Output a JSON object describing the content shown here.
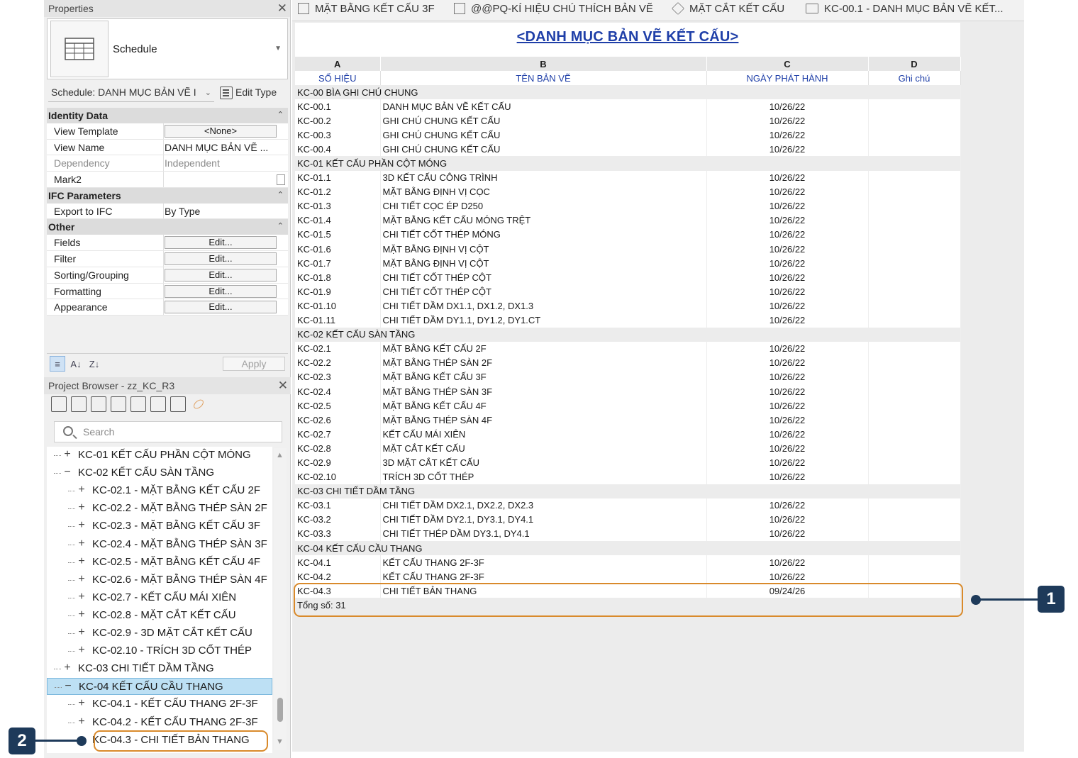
{
  "properties": {
    "title": "Properties",
    "type_name": "Schedule",
    "instance_label": "Schedule: DANH MỤC BẢN VẼ I",
    "edit_type": "Edit Type",
    "apply": "Apply",
    "sections": [
      {
        "title": "Identity Data",
        "rows": [
          {
            "name": "View Template",
            "value": "<None>",
            "kind": "button"
          },
          {
            "name": "View Name",
            "value": "DANH MỤC BẢN VẼ ...",
            "kind": "text"
          },
          {
            "name": "Dependency",
            "value": "Independent",
            "kind": "disabled"
          },
          {
            "name": "Mark2",
            "value": "",
            "kind": "check"
          }
        ]
      },
      {
        "title": "IFC Parameters",
        "rows": [
          {
            "name": "Export to IFC",
            "value": "By Type",
            "kind": "text"
          }
        ]
      },
      {
        "title": "Other",
        "rows": [
          {
            "name": "Fields",
            "value": "Edit...",
            "kind": "button"
          },
          {
            "name": "Filter",
            "value": "Edit...",
            "kind": "button"
          },
          {
            "name": "Sorting/Grouping",
            "value": "Edit...",
            "kind": "button"
          },
          {
            "name": "Formatting",
            "value": "Edit...",
            "kind": "button"
          },
          {
            "name": "Appearance",
            "value": "Edit...",
            "kind": "button"
          }
        ]
      }
    ]
  },
  "project_browser": {
    "title": "Project Browser - zz_KC_R3",
    "search_placeholder": "Search",
    "nodes": [
      {
        "level": 0,
        "toggle": "+",
        "label": "KC-01 KẾT CẤU PHẦN CỘT MÓNG"
      },
      {
        "level": 0,
        "toggle": "−",
        "label": "KC-02 KẾT CẤU SÀN TẦNG"
      },
      {
        "level": 1,
        "toggle": "+",
        "label": "KC-02.1 - MẶT BẰNG KẾT CẤU 2F"
      },
      {
        "level": 1,
        "toggle": "+",
        "label": "KC-02.2 - MẶT BẰNG THÉP SÀN 2F"
      },
      {
        "level": 1,
        "toggle": "+",
        "label": "KC-02.3 - MẶT BẰNG KẾT CẤU 3F"
      },
      {
        "level": 1,
        "toggle": "+",
        "label": "KC-02.4 - MẶT BẰNG THÉP SÀN 3F"
      },
      {
        "level": 1,
        "toggle": "+",
        "label": "KC-02.5 - MẶT BẰNG KẾT CẤU 4F"
      },
      {
        "level": 1,
        "toggle": "+",
        "label": "KC-02.6 - MẶT BẰNG THÉP SÀN 4F"
      },
      {
        "level": 1,
        "toggle": "+",
        "label": "KC-02.7 - KẾT CẤU MÁI XIÊN"
      },
      {
        "level": 1,
        "toggle": "+",
        "label": "KC-02.8 - MẶT CẮT KẾT CẤU"
      },
      {
        "level": 1,
        "toggle": "+",
        "label": "KC-02.9 - 3D MẶT CẮT KẾT CẤU"
      },
      {
        "level": 1,
        "toggle": "+",
        "label": "KC-02.10 - TRÍCH 3D CỐT THÉP"
      },
      {
        "level": 0,
        "toggle": "+",
        "label": "KC-03 CHI TIẾT DẦM TẦNG"
      },
      {
        "level": 0,
        "toggle": "−",
        "label": "KC-04 KẾT CẤU CẦU THANG",
        "selected": true
      },
      {
        "level": 1,
        "toggle": "+",
        "label": "KC-04.1 - KẾT CẤU THANG 2F-3F"
      },
      {
        "level": 1,
        "toggle": "+",
        "label": "KC-04.2 - KẾT CẤU THANG 2F-3F"
      },
      {
        "level": 1,
        "toggle": "",
        "label": "KC-04.3 - CHI TIẾT BẢN THANG"
      }
    ]
  },
  "tabs": [
    {
      "label": "MẶT BẰNG KẾT CẤU 3F",
      "icon": "floor-plan-icon"
    },
    {
      "label": "@@PQ-KÍ HIỆU CHÚ THÍCH BẢN VẼ",
      "icon": "legend-icon"
    },
    {
      "label": "MẶT CẮT KẾT CẤU",
      "icon": "section-icon"
    },
    {
      "label": "KC-00.1 - DANH MỤC BẢN VẼ KẾT...",
      "icon": "sheet-icon"
    }
  ],
  "schedule": {
    "title": "<DANH MỤC BẢN VẼ KẾT CẤU>",
    "column_letters": [
      "A",
      "B",
      "C",
      "D"
    ],
    "column_headers": [
      "SỐ HIỆU",
      "TÊN BẢN VẼ",
      "NGÀY PHÁT HÀNH",
      "Ghi chú"
    ],
    "rows": [
      {
        "group": "KC-00 BÌA GHI CHÚ CHUNG"
      },
      {
        "no": "KC-00.1",
        "name": "DANH MỤC BẢN VẼ KẾT CẤU",
        "date": "10/26/22"
      },
      {
        "no": "KC-00.2",
        "name": "GHI CHÚ CHUNG KẾT CẤU",
        "date": "10/26/22"
      },
      {
        "no": "KC-00.3",
        "name": "GHI CHÚ CHUNG KẾT CẤU",
        "date": "10/26/22"
      },
      {
        "no": "KC-00.4",
        "name": "GHI CHÚ CHUNG KẾT CẤU",
        "date": "10/26/22"
      },
      {
        "group": "KC-01 KẾT CẤU PHẦN CỘT MÓNG"
      },
      {
        "no": "KC-01.1",
        "name": "3D KẾT CẤU CÔNG TRÌNH",
        "date": "10/26/22"
      },
      {
        "no": "KC-01.2",
        "name": "MẶT BẰNG ĐỊNH VỊ CỌC",
        "date": "10/26/22"
      },
      {
        "no": "KC-01.3",
        "name": "CHI TIẾT CỌC ÉP D250",
        "date": "10/26/22"
      },
      {
        "no": "KC-01.4",
        "name": "MẶT BẰNG KẾT CẤU MÓNG TRỆT",
        "date": "10/26/22"
      },
      {
        "no": "KC-01.5",
        "name": "CHI TIẾT CỐT THÉP MÓNG",
        "date": "10/26/22"
      },
      {
        "no": "KC-01.6",
        "name": "MẶT BẰNG ĐỊNH VỊ CỘT",
        "date": "10/26/22"
      },
      {
        "no": "KC-01.7",
        "name": "MẶT BẰNG ĐỊNH VỊ CỘT",
        "date": "10/26/22"
      },
      {
        "no": "KC-01.8",
        "name": "CHI TIẾT CỐT THÉP CỘT",
        "date": "10/26/22"
      },
      {
        "no": "KC-01.9",
        "name": "CHI TIẾT CỐT THÉP CỘT",
        "date": "10/26/22"
      },
      {
        "no": "KC-01.10",
        "name": "CHI TIẾT DẦM DX1.1, DX1.2, DX1.3",
        "date": "10/26/22"
      },
      {
        "no": "KC-01.11",
        "name": "CHI TIẾT DẦM DY1.1, DY1.2, DY1.CT",
        "date": "10/26/22"
      },
      {
        "group": "KC-02 KẾT CẤU SÀN TẦNG"
      },
      {
        "no": "KC-02.1",
        "name": "MẶT BẰNG KẾT CẤU 2F",
        "date": "10/26/22"
      },
      {
        "no": "KC-02.2",
        "name": "MẶT BẰNG THÉP SÀN 2F",
        "date": "10/26/22"
      },
      {
        "no": "KC-02.3",
        "name": "MẶT BẰNG KẾT CẤU 3F",
        "date": "10/26/22"
      },
      {
        "no": "KC-02.4",
        "name": "MẶT BẰNG THÉP SÀN 3F",
        "date": "10/26/22"
      },
      {
        "no": "KC-02.5",
        "name": "MẶT BẰNG KẾT CẤU 4F",
        "date": "10/26/22"
      },
      {
        "no": "KC-02.6",
        "name": "MẶT BẰNG THÉP SÀN 4F",
        "date": "10/26/22"
      },
      {
        "no": "KC-02.7",
        "name": "KẾT CẤU MÁI XIÊN",
        "date": "10/26/22"
      },
      {
        "no": "KC-02.8",
        "name": "MẶT CẮT KẾT CẤU",
        "date": "10/26/22"
      },
      {
        "no": "KC-02.9",
        "name": "3D MẶT CẮT KẾT CẤU",
        "date": "10/26/22"
      },
      {
        "no": "KC-02.10",
        "name": "TRÍCH 3D CỐT THÉP",
        "date": "10/26/22"
      },
      {
        "group": "KC-03 CHI TIẾT DẦM TẦNG"
      },
      {
        "no": "KC-03.1",
        "name": "CHI TIẾT DẦM DX2.1, DX2.2, DX2.3",
        "date": "10/26/22"
      },
      {
        "no": "KC-03.2",
        "name": "CHI TIẾT DẦM DY2.1, DY3.1, DY4.1",
        "date": "10/26/22"
      },
      {
        "no": "KC-03.3",
        "name": "CHI TIẾT THÉP DẦM DY3.1, DY4.1",
        "date": "10/26/22"
      },
      {
        "group": "KC-04 KẾT CẤU CẦU THANG"
      },
      {
        "no": "KC-04.1",
        "name": "KẾT CẤU THANG 2F-3F",
        "date": "10/26/22"
      },
      {
        "no": "KC-04.2",
        "name": "KẾT CẤU THANG 2F-3F",
        "date": "10/26/22"
      },
      {
        "no": "KC-04.3",
        "name": "CHI TIẾT BẢN THANG",
        "date": "09/24/26"
      }
    ],
    "total": "Tổng số: 31"
  },
  "callouts": [
    {
      "number": "1",
      "color": "#1e3a5a"
    },
    {
      "number": "2",
      "color": "#1e3a5a"
    }
  ],
  "highlight_color": "#d98a2b",
  "accent_color": "#1f3fa8"
}
